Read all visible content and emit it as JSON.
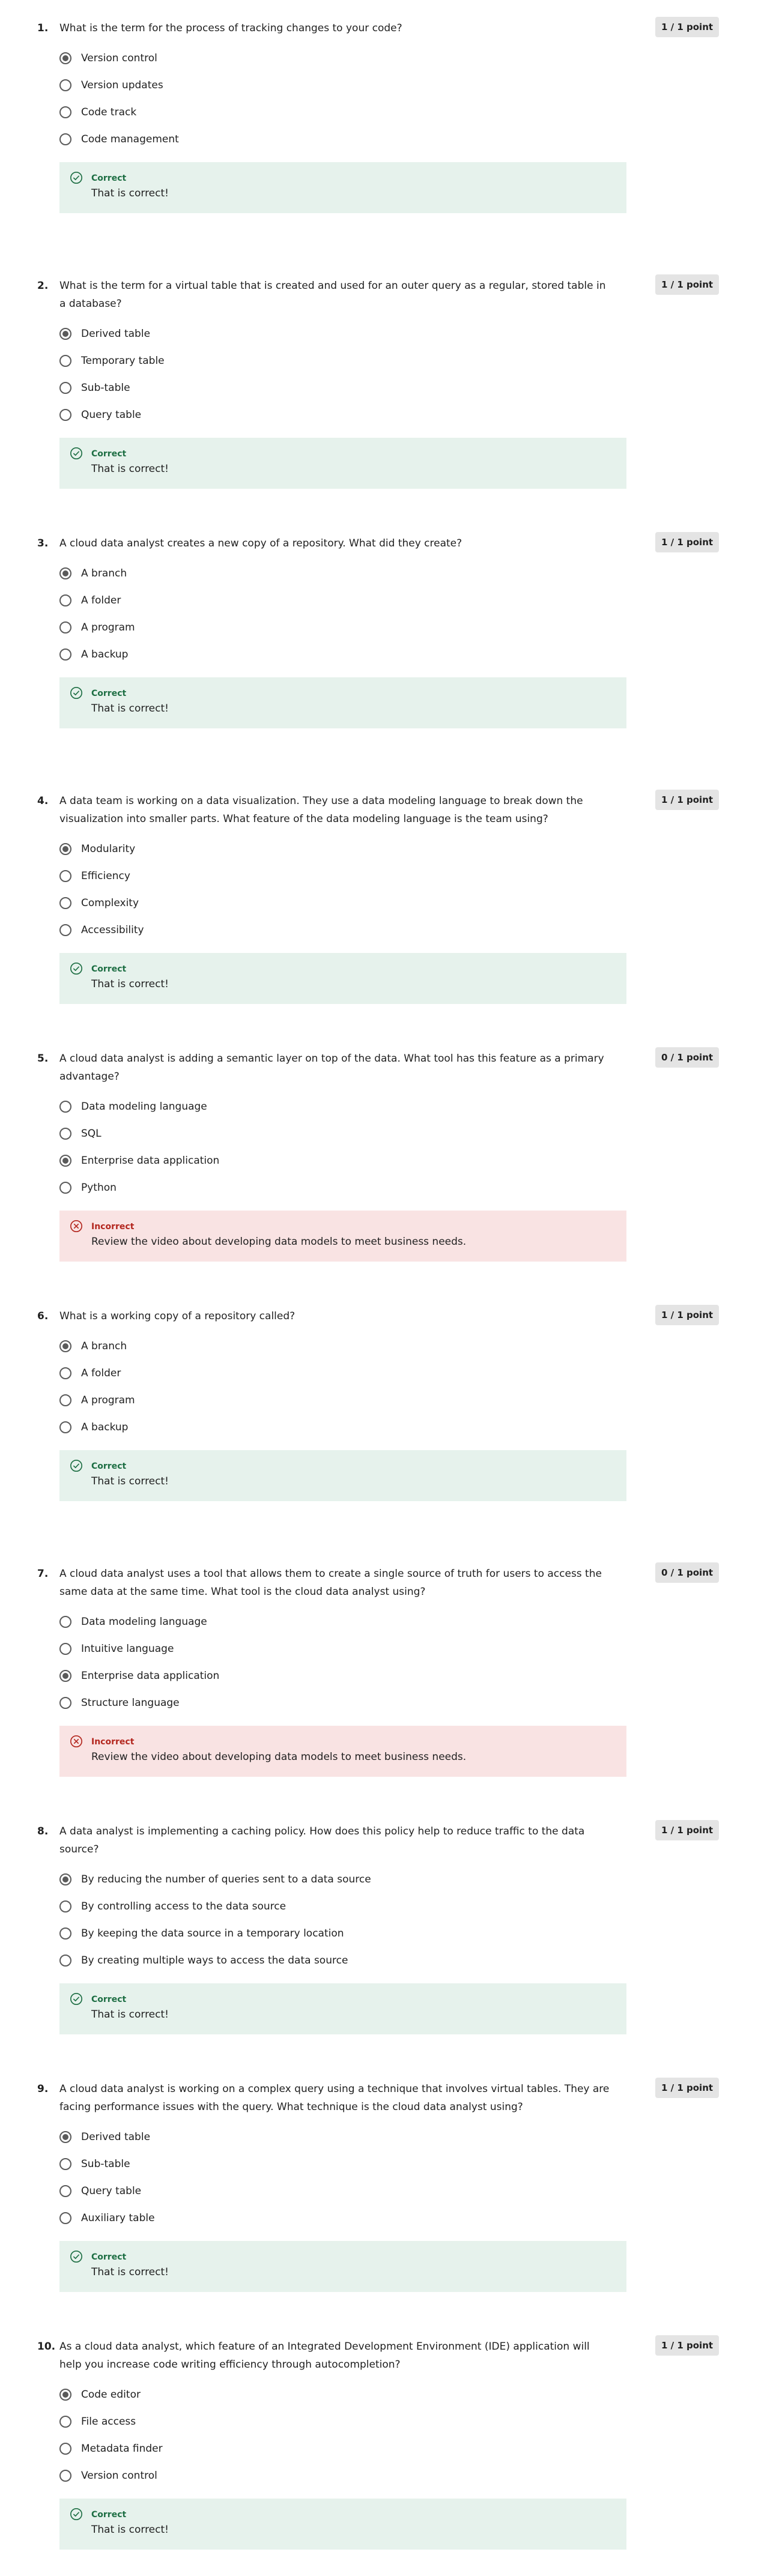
{
  "colors": {
    "correct_bg": "#e6f2ec",
    "correct_text": "#1d6e43",
    "incorrect_bg": "#f9e3e3",
    "incorrect_text": "#b3261e",
    "points_badge_bg": "#e4e4e4"
  },
  "questions": [
    {
      "number": "1.",
      "text": "What is the term for the process of tracking changes to your code?",
      "points": "1 / 1 point",
      "options": [
        "Version control",
        "Version updates",
        "Code track",
        "Code management"
      ],
      "selected": 0,
      "result": "correct",
      "status": "Correct",
      "message": "That is correct!"
    },
    {
      "number": "2.",
      "text": "What is the term for a virtual table that is created and used for an outer query as a regular, stored table in a database?",
      "points": "1 / 1 point",
      "options": [
        "Derived table",
        "Temporary table",
        "Sub-table",
        "Query table"
      ],
      "selected": 0,
      "result": "correct",
      "status": "Correct",
      "message": "That is correct!"
    },
    {
      "number": "3.",
      "text": "A cloud data analyst creates a new copy of a repository. What did they create?",
      "points": "1 / 1 point",
      "options": [
        "A branch",
        "A folder",
        "A program",
        "A backup"
      ],
      "selected": 0,
      "result": "correct",
      "status": "Correct",
      "message": "That is correct!"
    },
    {
      "number": "4.",
      "text": "A data team is working on a data visualization. They use a data modeling language to break down the visualization into smaller parts. What feature of the data modeling language is the team using?",
      "points": "1 / 1 point",
      "options": [
        "Modularity",
        "Efficiency",
        "Complexity",
        "Accessibility"
      ],
      "selected": 0,
      "result": "correct",
      "status": "Correct",
      "message": "That is correct!"
    },
    {
      "number": "5.",
      "text": "A cloud data analyst is adding a semantic layer on top of the data. What tool has this feature as a primary advantage?",
      "points": "0 / 1 point",
      "options": [
        "Data modeling language",
        "SQL",
        "Enterprise data application",
        "Python"
      ],
      "selected": 2,
      "result": "incorrect",
      "status": "Incorrect",
      "message": "Review the video about developing data models to meet business needs."
    },
    {
      "number": "6.",
      "text": "What is a working copy of a repository called?",
      "points": "1 / 1 point",
      "options": [
        "A branch",
        "A folder",
        "A program",
        "A backup"
      ],
      "selected": 0,
      "result": "correct",
      "status": "Correct",
      "message": "That is correct!"
    },
    {
      "number": "7.",
      "text": "A cloud data analyst uses a tool that allows them to create a single source of truth for users to access the same data at the same time. What tool is the cloud data analyst using?",
      "points": "0 / 1 point",
      "options": [
        "Data modeling language",
        "Intuitive language",
        "Enterprise data application",
        "Structure language"
      ],
      "selected": 2,
      "result": "incorrect",
      "status": "Incorrect",
      "message": "Review the video about developing data models to meet business needs."
    },
    {
      "number": "8.",
      "text": "A data analyst is implementing a caching policy. How does this policy help to reduce traffic to the data source?",
      "points": "1 / 1 point",
      "options": [
        "By reducing the number of queries sent to a data source",
        "By controlling access to the data source",
        "By keeping the data source in a temporary location",
        "By creating multiple ways to access the data source"
      ],
      "selected": 0,
      "result": "correct",
      "status": "Correct",
      "message": "That is correct!"
    },
    {
      "number": "9.",
      "text": "A cloud data analyst is working on a complex query using a technique that involves virtual tables. They are facing performance issues with the query. What technique is the cloud data analyst using?",
      "points": "1 / 1 point",
      "options": [
        "Derived table",
        "Sub-table",
        "Query table",
        "Auxiliary table"
      ],
      "selected": 0,
      "result": "correct",
      "status": "Correct",
      "message": "That is correct!"
    },
    {
      "number": "10.",
      "text": "As a cloud data analyst, which feature of an Integrated Development Environment (IDE) application will help you increase code writing efficiency through autocompletion?",
      "points": "1 / 1 point",
      "options": [
        "Code editor",
        "File access",
        "Metadata finder",
        "Version control"
      ],
      "selected": 0,
      "result": "correct",
      "status": "Correct",
      "message": "That is correct!"
    }
  ]
}
